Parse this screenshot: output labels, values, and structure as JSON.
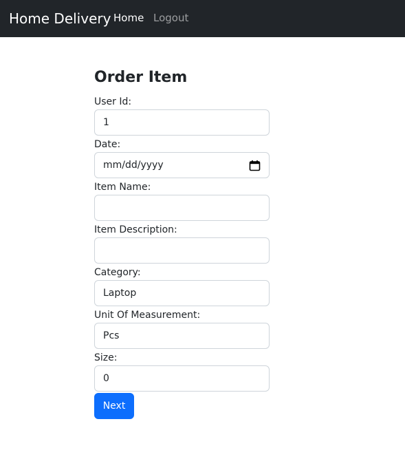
{
  "navbar": {
    "brand": "Home Delivery",
    "links": [
      "Home",
      "Logout"
    ]
  },
  "form": {
    "title": "Order Item",
    "fields": {
      "user_id": {
        "label": "User Id:",
        "value": "1"
      },
      "date": {
        "label": "Date:",
        "value": "mm/dd/yyyy"
      },
      "item_name": {
        "label": "Item Name:",
        "value": ""
      },
      "item_description": {
        "label": "Item Description:",
        "value": ""
      },
      "category": {
        "label": "Category:",
        "value": "Laptop"
      },
      "unit_of_measurement": {
        "label": "Unit Of Measurement:",
        "value": "Pcs"
      },
      "size": {
        "label": "Size:",
        "value": "0"
      }
    },
    "next_label": "Next"
  },
  "colors": {
    "navbar_bg": "#212529",
    "primary": "#0d6efd",
    "border": "#ced4da"
  },
  "icons": [
    "calendar-icon"
  ]
}
